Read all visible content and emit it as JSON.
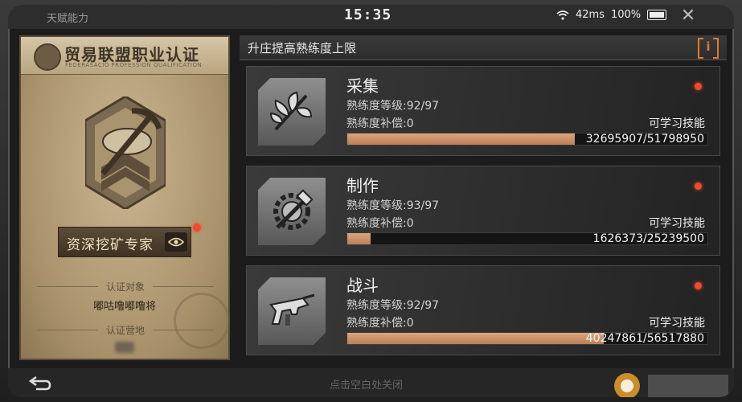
{
  "status": {
    "app_title": "天赋能力",
    "time": "15:35",
    "ping": "42ms",
    "battery": "100%"
  },
  "certificate": {
    "title": "贸易联盟职业认证",
    "subtitle": "FEDERASACIO PROFESSION QUALIFICATION",
    "rank": "资深挖矿专家",
    "target_label": "认证对象",
    "target_value": "嘟咕噜嘟噜将",
    "camp_label": "认证营地"
  },
  "panel": {
    "title": "升庄提高熟练度上限",
    "info": "i"
  },
  "skills": [
    {
      "name": "采集",
      "level": "熟练度等级:92/97",
      "bonus": "熟练度补偿:0",
      "learn": "可学习技能",
      "progress": "32695907/51798950",
      "fill": 0.631,
      "icon": "leaf-icon"
    },
    {
      "name": "制作",
      "level": "熟练度等级:93/97",
      "bonus": "熟练度补偿:0",
      "learn": "可学习技能",
      "progress": "1626373/25239500",
      "fill": 0.064,
      "icon": "hammer-gear-icon"
    },
    {
      "name": "战斗",
      "level": "熟练度等级:92/97",
      "bonus": "熟练度补偿:0",
      "learn": "可学习技能",
      "progress": "40247861/56517880",
      "fill": 0.712,
      "icon": "gun-icon"
    }
  ],
  "bottom": {
    "hint": "点击空白处关闭"
  },
  "colors": {
    "accent": "#e07a2c",
    "progress": "#c98e64",
    "alert_dot": "#f04a2a"
  }
}
